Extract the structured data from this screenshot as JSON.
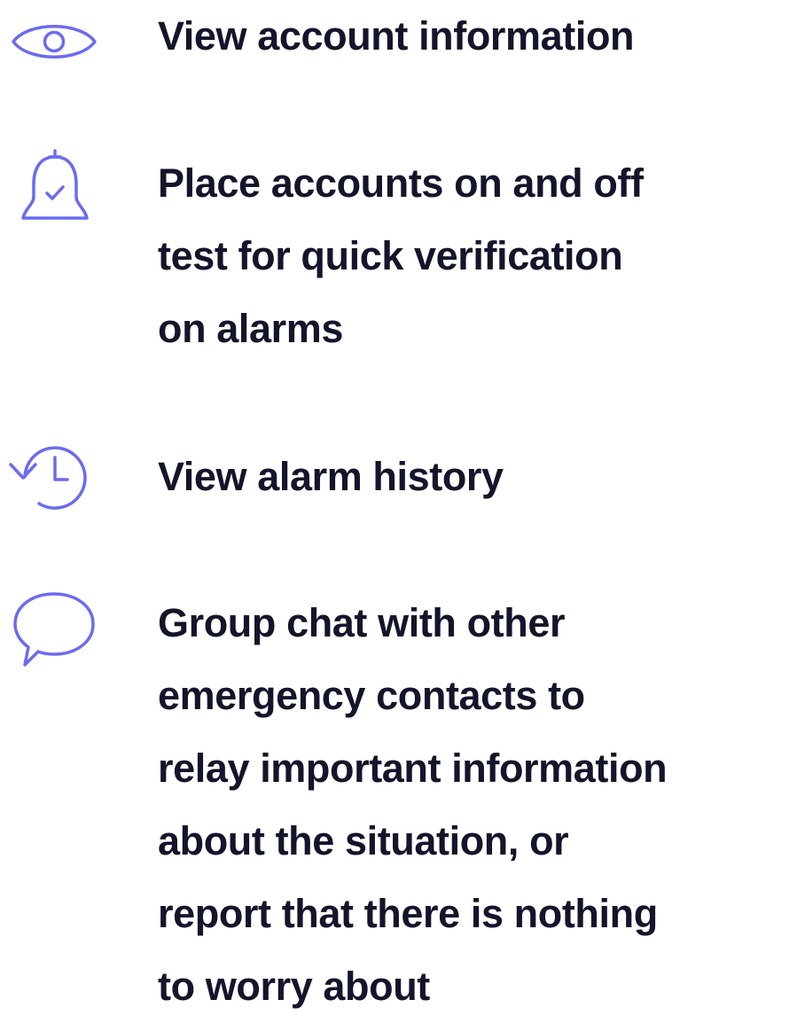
{
  "colors": {
    "icon_stroke": "#6b6bf0",
    "text": "#14142b",
    "background": "#ffffff"
  },
  "features": [
    {
      "icon": "eye-icon",
      "lines": [
        "View account information"
      ]
    },
    {
      "icon": "bell-check-icon",
      "lines": [
        "Place accounts on and off",
        "test for quick verification",
        "on alarms"
      ]
    },
    {
      "icon": "history-icon",
      "lines": [
        "View alarm history"
      ]
    },
    {
      "icon": "chat-bubble-icon",
      "lines": [
        "Group chat with other",
        "emergency contacts to",
        "relay important information",
        "about the situation, or",
        "report that there is nothing",
        "to worry about"
      ]
    }
  ]
}
